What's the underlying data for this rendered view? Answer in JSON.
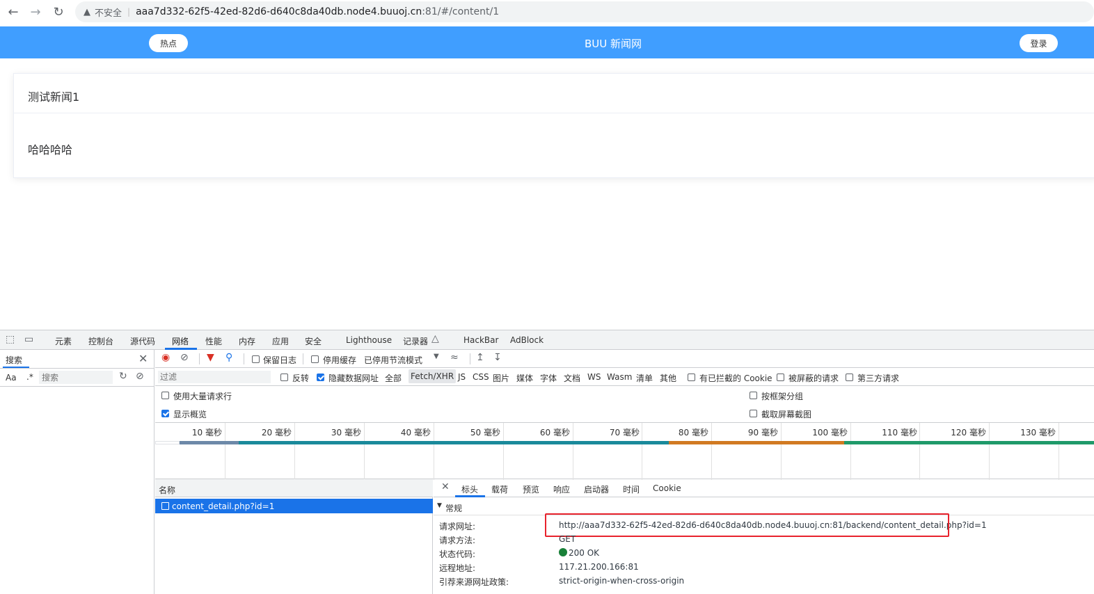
{
  "browser": {
    "insecure_label": "不安全",
    "url_host": "aaa7d332-62f5-42ed-82d6-d640c8da40db.node4.buuoj.cn",
    "url_rest": ":81/#/content/1"
  },
  "page": {
    "hot_button": "热点",
    "site_title": "BUU 新闻网",
    "login_button": "登录",
    "news_title": "测试新闻1",
    "news_body": "哈哈哈哈"
  },
  "devtools": {
    "tabs": [
      "元素",
      "控制台",
      "源代码",
      "网络",
      "性能",
      "内存",
      "应用",
      "安全",
      "Lighthouse",
      "记录器",
      "HackBar",
      "AdBlock"
    ],
    "active_tab": "网络",
    "search": {
      "label": "搜索",
      "case_label": "Aa",
      "regex_label": ".*",
      "placeholder": "搜索"
    },
    "toolbar": {
      "preserve_log": "保留日志",
      "disable_cache": "停用缓存",
      "throttle": "已停用节流模式"
    },
    "filter": {
      "placeholder": "过滤",
      "invert": "反转",
      "hide_data_urls": "隐藏数据网址",
      "types": [
        "全部",
        "Fetch/XHR",
        "JS",
        "CSS",
        "图片",
        "媒体",
        "字体",
        "文档",
        "WS",
        "Wasm",
        "清单",
        "其他"
      ],
      "active_type": "Fetch/XHR",
      "blocked_cookies": "有已拦截的 Cookie",
      "blocked_requests": "被屏蔽的请求",
      "third_party": "第三方请求"
    },
    "options": {
      "big_rows": "使用大量请求行",
      "overview": "显示概览",
      "group_by_frame": "按框架分组",
      "screenshots": "截取屏幕截图"
    },
    "timeline_ticks": [
      "10 毫秒",
      "20 毫秒",
      "30 毫秒",
      "40 毫秒",
      "50 毫秒",
      "60 毫秒",
      "70 毫秒",
      "80 毫秒",
      "90 毫秒",
      "100 毫秒",
      "110 毫秒",
      "120 毫秒",
      "130 毫秒"
    ],
    "names_header": "名称",
    "request_name": "content_detail.php?id=1",
    "detail_tabs": [
      "标头",
      "载荷",
      "预览",
      "响应",
      "启动器",
      "时间",
      "Cookie"
    ],
    "general_label": "常规",
    "general": {
      "url_key": "请求网址:",
      "url_val": "http://aaa7d332-62f5-42ed-82d6-d640c8da40db.node4.buuoj.cn:81/backend/content_detail.php?id=1",
      "method_key": "请求方法:",
      "method_val": "GET",
      "status_key": "状态代码:",
      "status_val": "200 OK",
      "remote_key": "远程地址:",
      "remote_val": "117.21.200.166:81",
      "referrer_key": "引荐来源网址政策:",
      "referrer_val": "strict-origin-when-cross-origin"
    },
    "colors": {
      "accent": "#1a73e8",
      "highlight": "#e8222c",
      "status_ok": "#188038",
      "header_blue": "#409eff"
    }
  }
}
